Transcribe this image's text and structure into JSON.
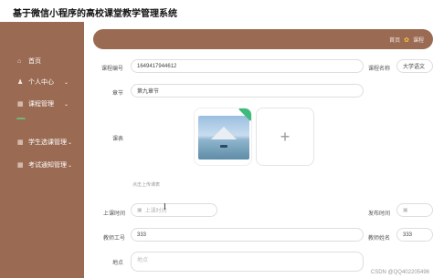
{
  "app": {
    "title": "基于微信小程序的高校课堂教学管理系统"
  },
  "sidebar": {
    "items": [
      {
        "icon": "home-icon",
        "glyph": "⌂",
        "label": "首页"
      },
      {
        "icon": "user-icon",
        "glyph": "♟",
        "label": "个人中心"
      },
      {
        "icon": "grid-icon",
        "glyph": "▦",
        "label": "课程管理"
      },
      {
        "icon": "grid-icon",
        "glyph": "▦",
        "label": "学生选课管理"
      },
      {
        "icon": "grid-icon",
        "glyph": "▦",
        "label": "考试通知管理"
      }
    ]
  },
  "breadcrumb": {
    "home": "首页",
    "current": "课程"
  },
  "form": {
    "course_no_label": "课程编号",
    "course_no_value": "1649417944612",
    "course_name_label": "课程名称",
    "course_name_value": "大学语文",
    "chapter_label": "章节",
    "chapter_value": "第九章节",
    "video_label": "课表",
    "upload_hint": "点击上传课表",
    "start_time_label": "上课时间",
    "start_time_placeholder": "上课时间",
    "publish_time_label": "发布时间",
    "teacher_no_label": "教师工号",
    "teacher_no_value": "333",
    "teacher_name_label": "教师姓名",
    "teacher_name_value": "333",
    "location_label": "地点",
    "location_placeholder": "地点"
  },
  "watermark": "CSDN @QQ4022054​96"
}
